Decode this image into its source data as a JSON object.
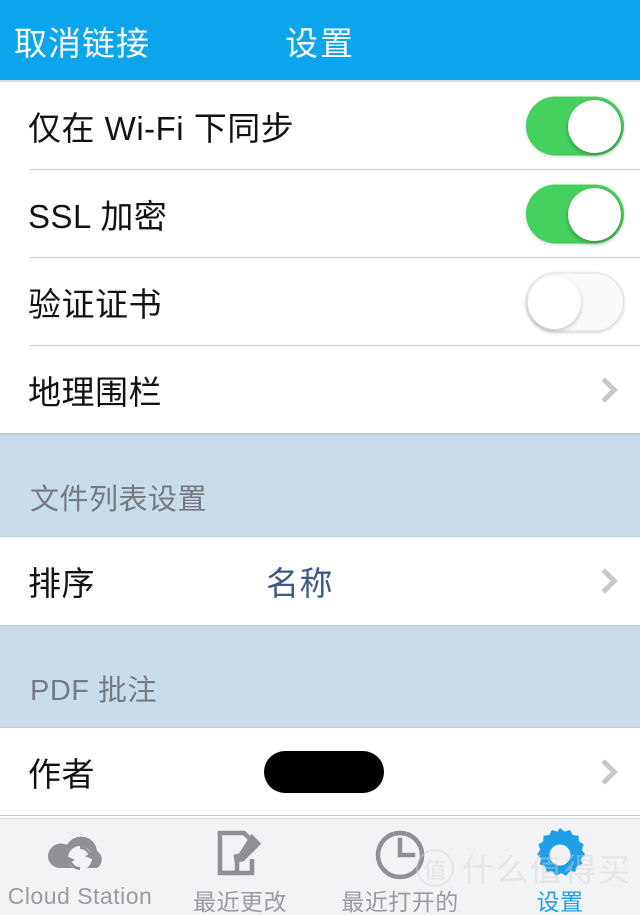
{
  "header": {
    "back_label": "取消链接",
    "title": "设置",
    "bar_color": "#0ba5ee"
  },
  "colors": {
    "accent_blue": "#0ba5ee",
    "toggle_on_green": "#45d15e",
    "section_header_bg": "#c9dcea",
    "value_text": "#3e5a85",
    "chevron_gray": "#c7c7cc",
    "tab_active": "#1e9fe8",
    "tab_inactive": "#9a9b9e",
    "tabbar_bg": "#f2f3f5"
  },
  "sections": [
    {
      "header": null,
      "rows": [
        {
          "label": "仅在 Wi-Fi 下同步",
          "control": "toggle",
          "toggle_state": "on"
        },
        {
          "label": "SSL 加密",
          "control": "toggle",
          "toggle_state": "on"
        },
        {
          "label": "验证证书",
          "control": "toggle",
          "toggle_state": "off"
        },
        {
          "label": "地理围栏",
          "control": "chevron"
        }
      ]
    },
    {
      "header": "文件列表设置",
      "rows": [
        {
          "label": "排序",
          "value": "名称",
          "control": "chevron"
        }
      ]
    },
    {
      "header": "PDF 批注",
      "rows": [
        {
          "label": "作者",
          "value": "",
          "redacted": true,
          "control": "chevron"
        }
      ]
    }
  ],
  "tabbar": {
    "items": [
      {
        "label": "Cloud Station",
        "icon": "cloud-sync-icon",
        "active": false
      },
      {
        "label": "最近更改",
        "icon": "document-pencil-icon",
        "active": false
      },
      {
        "label": "最近打开的",
        "icon": "clock-icon",
        "active": false
      },
      {
        "label": "设置",
        "icon": "gear-icon",
        "active": true
      }
    ]
  },
  "watermark": {
    "badge": "值",
    "text": "什么值得买"
  }
}
